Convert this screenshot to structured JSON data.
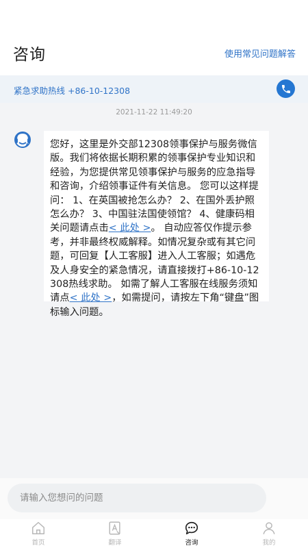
{
  "header": {
    "title": "咨询",
    "faq_link": "使用常见问题解答"
  },
  "hotline": {
    "label": "紧急求助热线 +86-10-12308",
    "icon": "phone-icon"
  },
  "chat": {
    "timestamp": "2021-11-22 11:49:20",
    "message": {
      "part1": "您好，这里是外交部12308领事保护与服务微信版。我们将依据长期积累的领事保护专业知识和经验，为您提供常见领事保护与服务的应急指导和咨询，介绍领事证件有关信息。 您可以这样提问： 1、在英国被抢怎么办？ 2、在国外丢护照怎么办？ 3、中国驻法国使领馆？ 4、健康码相关问题请点击",
      "link1": "< 此处 >",
      "part2": "。 自动应答仅作提示参考，并非最终权威解释。如情况复杂或有其它问题，可回复【人工客服】进入人工客服；如遇危及人身安全的紧急情况，请直接拨打+86-10-12308热线求助。 如需了解人工客服在线服务须知请点",
      "link2": "< 此处 >",
      "part3": "，如需提问，请按左下角“键盘”图标输入问题。"
    }
  },
  "input": {
    "placeholder": "请输入您想问的问题"
  },
  "tabs": [
    {
      "label": "首页",
      "icon": "home-icon",
      "active": false
    },
    {
      "label": "翻译",
      "icon": "translate-icon",
      "active": false
    },
    {
      "label": "咨询",
      "icon": "chat-icon",
      "active": true
    },
    {
      "label": "我的",
      "icon": "profile-icon",
      "active": false
    }
  ],
  "colors": {
    "accent": "#2f73c7",
    "phone_button": "#2577d2",
    "chat_background": "#f3f4f6",
    "hotline_background": "#eef3f8"
  }
}
